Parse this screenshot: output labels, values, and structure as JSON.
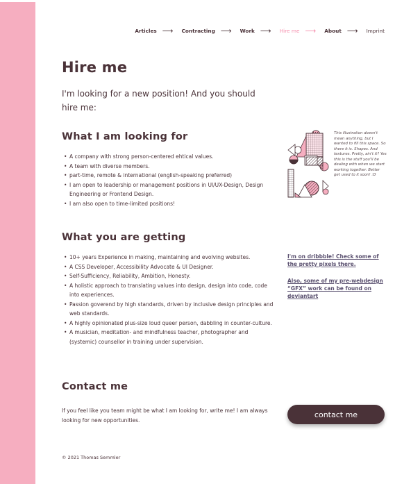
{
  "nav": [
    {
      "label": "Articles",
      "arrow": "⟶"
    },
    {
      "label": "Contracting",
      "arrow": "⟶"
    },
    {
      "label": "Work",
      "arrow": "⟶"
    },
    {
      "label": "Hire me",
      "arrow": "⟶"
    },
    {
      "label": "About",
      "arrow": "⟶"
    },
    {
      "label": "Imprint"
    }
  ],
  "page": {
    "title": "Hire me",
    "intro": "I'm looking for a new position! And you should hire me:"
  },
  "looking": {
    "heading": "What I am looking for",
    "items": [
      "A company with strong person-centered ehtical values.",
      "A team with diverse members.",
      "part-time, remote & international (english-speaking preferred)",
      "I am open to leadership or management positions in UI/UX-Design, Design Engineering or Frontend Design.",
      "I am also open to time-limited positions!"
    ],
    "illustration_note": "This illustration doesn't mean anything, but I wanted to fill this space. So there it is. Shapes. And textures. Pretty, ain't it? Yes this is the stuff you'll be dealing with when we start working together. Better get used to it soon! :D"
  },
  "getting": {
    "heading": "What you are getting",
    "items": [
      "10+ years Experience in making, maintaining and evolving websites.",
      "A CSS Developer, Accessibility Advocate & UI Designer.",
      "Self-Sufficiency, Reliability, Ambition, Honesty.",
      "A holistic approach to translating values into design, design into code, code into experiences.",
      "Passion goverend by high standards, driven by inclusive design principles and web standards.",
      "A highly opinionated plus-size loud queer person, dabbling in counter-culture.",
      "A musician, meditation- and mindfulness teacher, photographer and (systemic) counsellor in training under supervision."
    ],
    "links": [
      "I'm on dribbble! Check some of the pretty pixels there.",
      "Also, some of my pre-webdesign “GFX” work can be found on deviantart"
    ]
  },
  "contact": {
    "heading": "Contact me",
    "text": "If you feel like you team might be what I am looking for, write me! I am always looking for new opportunities.",
    "button": "contact me"
  },
  "footer": "© 2021 Thomas Semmler",
  "colors": {
    "sidebar": "#f6aec0",
    "text": "#4a3238",
    "active_nav": "#f58cab",
    "link": "#5b5170",
    "button": "#4a3238"
  }
}
